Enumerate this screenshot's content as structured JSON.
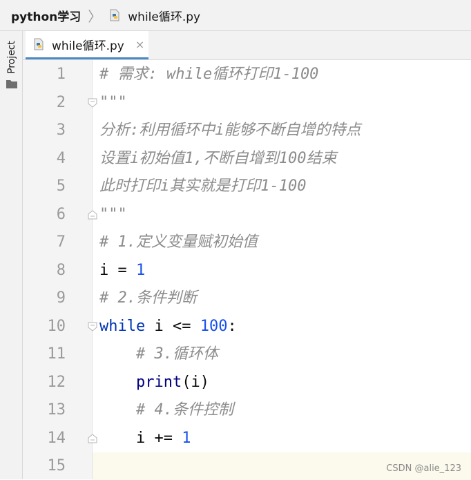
{
  "breadcrumb": {
    "project": "python学习",
    "file": "while循环.py"
  },
  "sidebar": {
    "project_tab": "Project"
  },
  "editor_tab": {
    "label": "while循环.py",
    "close": "×"
  },
  "lines": [
    {
      "n": "1",
      "tokens": [
        {
          "t": "# 需求: while循环打印1-100",
          "c": "cm"
        }
      ]
    },
    {
      "n": "2",
      "tokens": [
        {
          "t": "\"\"\"",
          "c": "cm"
        }
      ]
    },
    {
      "n": "3",
      "tokens": [
        {
          "t": "分析:利用循环中i能够不断自增的特点",
          "c": "cm"
        }
      ]
    },
    {
      "n": "4",
      "tokens": [
        {
          "t": "设置i初始值1,不断自增到100结束",
          "c": "cm"
        }
      ]
    },
    {
      "n": "5",
      "tokens": [
        {
          "t": "此时打印i其实就是打印1-100",
          "c": "cm"
        }
      ]
    },
    {
      "n": "6",
      "tokens": [
        {
          "t": "\"\"\"",
          "c": "cm"
        }
      ]
    },
    {
      "n": "7",
      "tokens": [
        {
          "t": "# 1.定义变量赋初始值",
          "c": "cm"
        }
      ]
    },
    {
      "n": "8",
      "tokens": [
        {
          "t": "i = ",
          "c": ""
        },
        {
          "t": "1",
          "c": "num"
        }
      ]
    },
    {
      "n": "9",
      "tokens": [
        {
          "t": "# 2.条件判断",
          "c": "cm"
        }
      ]
    },
    {
      "n": "10",
      "tokens": [
        {
          "t": "while",
          "c": "kw"
        },
        {
          "t": " i <= ",
          "c": ""
        },
        {
          "t": "100",
          "c": "num"
        },
        {
          "t": ":",
          "c": ""
        }
      ]
    },
    {
      "n": "11",
      "tokens": [
        {
          "t": "    ",
          "c": ""
        },
        {
          "t": "# 3.循环体",
          "c": "cm"
        }
      ]
    },
    {
      "n": "12",
      "tokens": [
        {
          "t": "    ",
          "c": ""
        },
        {
          "t": "print",
          "c": "fn"
        },
        {
          "t": "(i)",
          "c": ""
        }
      ]
    },
    {
      "n": "13",
      "tokens": [
        {
          "t": "    ",
          "c": ""
        },
        {
          "t": "# 4.条件控制",
          "c": "cm"
        }
      ]
    },
    {
      "n": "14",
      "tokens": [
        {
          "t": "    i += ",
          "c": ""
        },
        {
          "t": "1",
          "c": "num"
        }
      ]
    },
    {
      "n": "15",
      "tokens": []
    }
  ],
  "folds": {
    "open_lines": [
      2,
      10
    ],
    "close_lines": [
      6,
      14
    ]
  },
  "watermark": "CSDN @alie_123",
  "colors": {
    "keyword": "#0033b3",
    "number": "#1750eb",
    "comment": "#8c8c8c",
    "builtin": "#000080",
    "tab_accent": "#4a88c7"
  }
}
